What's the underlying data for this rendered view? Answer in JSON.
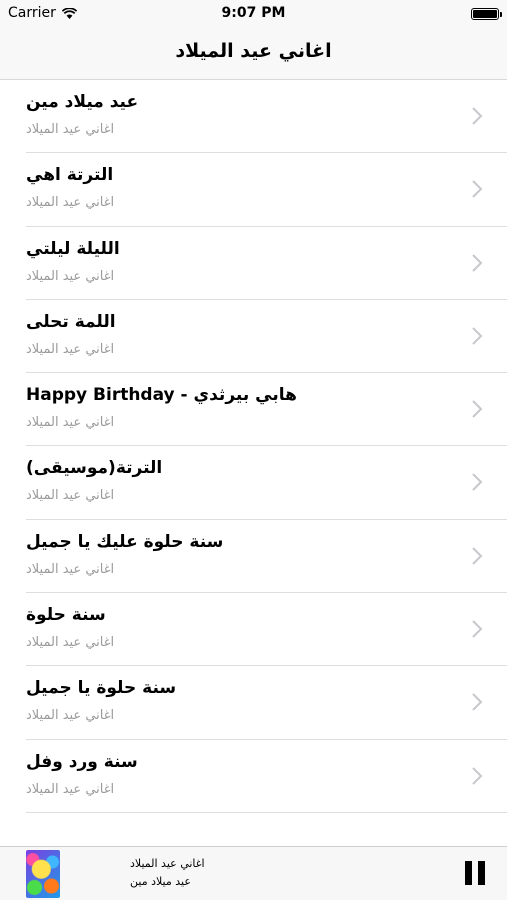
{
  "status_bar": {
    "carrier": "Carrier",
    "time": "9:07 PM",
    "battery_level": 1.0
  },
  "nav": {
    "title": "اغاني عيد الميلاد"
  },
  "songs": [
    {
      "title": "عيد ميلاد مين",
      "subtitle": "اغاني عيد الميلاد"
    },
    {
      "title": "الترتة اهي",
      "subtitle": "اغاني عيد الميلاد"
    },
    {
      "title": "الليلة ليلتي",
      "subtitle": "اغاني عيد الميلاد"
    },
    {
      "title": "اللمة تحلى",
      "subtitle": "اغاني عيد الميلاد"
    },
    {
      "title": "Happy Birthday - هابي بيرثدي",
      "subtitle": "اغاني عيد الميلاد"
    },
    {
      "title": "الترتة(موسيقى)",
      "subtitle": "اغاني عيد الميلاد"
    },
    {
      "title": "سنة حلوة عليك يا جميل",
      "subtitle": "اغاني عيد الميلاد"
    },
    {
      "title": "سنة حلوة",
      "subtitle": "اغاني عيد الميلاد"
    },
    {
      "title": "سنة حلوة يا جميل",
      "subtitle": "اغاني عيد الميلاد"
    },
    {
      "title": "سنة ورد وفل",
      "subtitle": "اغاني عيد الميلاد"
    }
  ],
  "player": {
    "album": "اغاني عيد الميلاد",
    "track": "عيد ميلاد مين",
    "artwork_icon": "balloons-artwork",
    "control_icon": "pause-icon"
  }
}
